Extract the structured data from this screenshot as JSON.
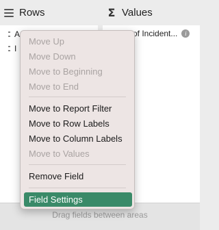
{
  "header": {
    "rows_title": "Rows",
    "values_title": "Values"
  },
  "rows_list": {
    "items": [
      {
        "label": "A"
      },
      {
        "label": "I"
      }
    ]
  },
  "values_list": {
    "items": [
      {
        "label": "of Incident..."
      }
    ]
  },
  "icons": {
    "rows": "rows-icon",
    "values": "sigma-icon",
    "info": "info-icon",
    "grip": "drag-handle-icon"
  },
  "menu": {
    "group1": [
      "Move Up",
      "Move Down",
      "Move to Beginning",
      "Move to End"
    ],
    "group2": [
      "Move to Report Filter",
      "Move to Row Labels",
      "Move to Column Labels",
      "Move to Values"
    ],
    "group3": [
      "Remove Field"
    ],
    "selected": "Field Settings"
  },
  "footer": {
    "hint": "Drag fields between areas"
  },
  "colors": {
    "selection": "#3a8a68",
    "menu_bg": "#ede5e4"
  }
}
